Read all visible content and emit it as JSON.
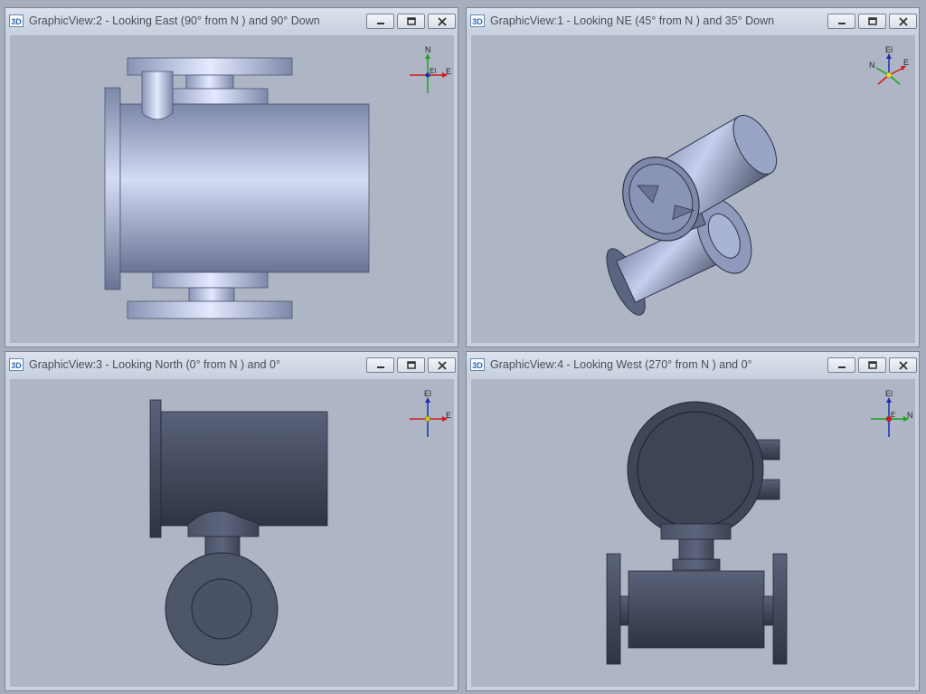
{
  "views": [
    {
      "icon": "3D",
      "title": "GraphicView:2 - Looking East (90° from N ) and 90° Down",
      "triad": {
        "up": "N",
        "right": "E",
        "center": "El"
      }
    },
    {
      "icon": "3D",
      "title": "GraphicView:1 - Looking NE (45° from N ) and 35° Down",
      "triad": {
        "up": "El",
        "left": "N",
        "right": "E"
      }
    },
    {
      "icon": "3D",
      "title": "GraphicView:3 - Looking North (0° from N ) and 0°",
      "triad": {
        "up": "El",
        "right": "E"
      }
    },
    {
      "icon": "3D",
      "title": "GraphicView:4 - Looking West (270° from N ) and 0°",
      "triad": {
        "up": "El",
        "right": "N",
        "center": "E"
      }
    }
  ],
  "colors": {
    "viewport_bg": "#aeb6c5",
    "model_light": "#b8c3e6",
    "model_dark": "#3e4556",
    "triad_x": "#d11a1a",
    "triad_y": "#1aa31a",
    "triad_z": "#1a2fb3"
  }
}
